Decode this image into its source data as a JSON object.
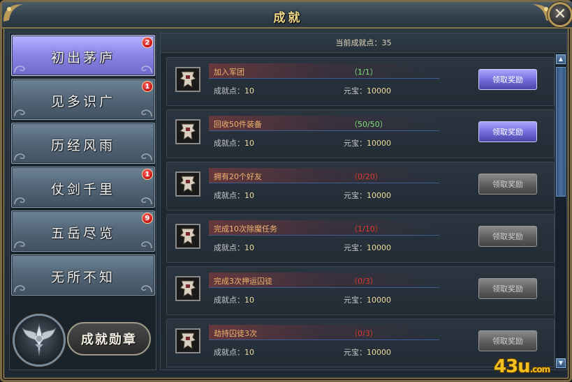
{
  "window": {
    "title": "成就",
    "close_icon": "close-icon"
  },
  "sidebar": {
    "categories": [
      {
        "label": "初出茅庐",
        "badge": "2",
        "active": true
      },
      {
        "label": "见多识广",
        "badge": "1",
        "active": false
      },
      {
        "label": "历经风雨",
        "badge": "",
        "active": false
      },
      {
        "label": "仗剑千里",
        "badge": "1",
        "active": false
      },
      {
        "label": "五岳尽览",
        "badge": "9",
        "active": false
      },
      {
        "label": "无所不知",
        "badge": "",
        "active": false
      }
    ],
    "medal_button": "成就勋章",
    "medal_icon": "winged-sword-medal-icon"
  },
  "content": {
    "points_label": "当前成就点：35",
    "points_prefix": "成就点：",
    "gold_prefix": "元宝：",
    "achievements": [
      {
        "name": "加入军团",
        "progress": "（1/1）",
        "complete": true,
        "points": "10",
        "gold": "10000",
        "button": "领取奖励",
        "claimable": true
      },
      {
        "name": "回收50件装备",
        "progress": "（50/50）",
        "complete": true,
        "points": "10",
        "gold": "10000",
        "button": "领取奖励",
        "claimable": true
      },
      {
        "name": "拥有20个好友",
        "progress": "（0/20）",
        "complete": false,
        "points": "10",
        "gold": "10000",
        "button": "领取奖励",
        "claimable": false
      },
      {
        "name": "完成10次除魔任务",
        "progress": "（1/10）",
        "complete": false,
        "points": "10",
        "gold": "10000",
        "button": "领取奖励",
        "claimable": false
      },
      {
        "name": "完成3次押运囚徒",
        "progress": "（0/3）",
        "complete": false,
        "points": "10",
        "gold": "10000",
        "button": "领取奖励",
        "claimable": false
      },
      {
        "name": "劫持囚徒3次",
        "progress": "（0/3）",
        "complete": false,
        "points": "10",
        "gold": "10000",
        "button": "领取奖励",
        "claimable": false
      }
    ]
  },
  "watermark": {
    "main": "43u",
    "suffix": ".com"
  },
  "colors": {
    "accent_gold": "#f2d98a",
    "claim_active": "#6f6ad8",
    "progress_done": "#7fe07a",
    "progress_todo": "#e23a2a"
  }
}
